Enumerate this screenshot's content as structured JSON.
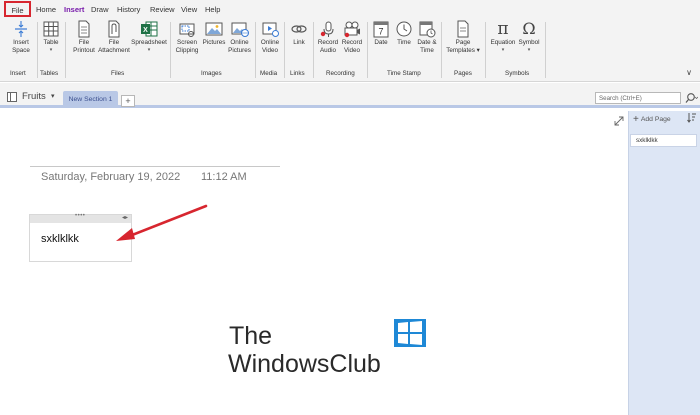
{
  "menu": {
    "tabs": [
      "File",
      "Home",
      "Insert",
      "Draw",
      "History",
      "Review",
      "View",
      "Help"
    ],
    "active": "Insert"
  },
  "ribbon": {
    "insert_space": [
      "Insert",
      "Space"
    ],
    "table": [
      "Table"
    ],
    "file_printout": [
      "File",
      "Printout"
    ],
    "file_attachment": [
      "File",
      "Attachment"
    ],
    "spreadsheet": [
      "Spreadsheet"
    ],
    "screen_clipping": [
      "Screen",
      "Clipping"
    ],
    "pictures": [
      "Pictures"
    ],
    "online_pictures": [
      "Online",
      "Pictures"
    ],
    "online_video": [
      "Online",
      "Video"
    ],
    "link": [
      "Link"
    ],
    "record_audio": [
      "Record",
      "Audio"
    ],
    "record_video": [
      "Record",
      "Video"
    ],
    "date": [
      "Date"
    ],
    "time": [
      "Time"
    ],
    "date_time": [
      "Date &",
      "Time"
    ],
    "page_templates": [
      "Page",
      "Templates"
    ],
    "equation": [
      "Equation"
    ],
    "symbol": [
      "Symbol"
    ],
    "groups": {
      "insert": "Insert",
      "tables": "Tables",
      "files": "Files",
      "images": "Images",
      "media": "Media",
      "links": "Links",
      "recording": "Recording",
      "time_stamp": "Time Stamp",
      "pages": "Pages",
      "symbols": "Symbols"
    },
    "equation_glyph": "π",
    "symbol_glyph": "Ω"
  },
  "notebook": {
    "name": "Fruits",
    "section": "New Section 1",
    "add_section": "+",
    "search_placeholder": "Search (Ctrl+E)"
  },
  "page": {
    "date": "Saturday, February 19, 2022",
    "time": "11:12 AM",
    "note_text": "sxklklkk"
  },
  "pages_panel": {
    "add_page": "Add Page",
    "items": [
      "sxklklkk"
    ]
  },
  "watermark": {
    "line1": "The",
    "line2": "WindowsClub"
  },
  "colors": {
    "accent": "#7719aa",
    "highlight_red": "#d7262f",
    "section_tab": "#b9c8e6",
    "pages_panel": "#dde6f5"
  }
}
